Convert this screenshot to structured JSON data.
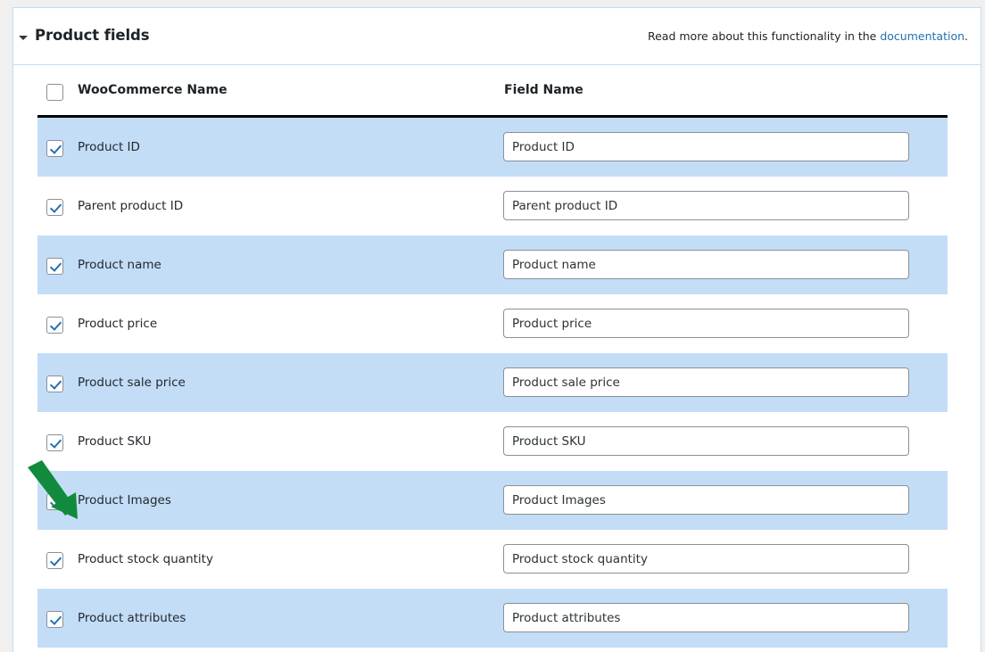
{
  "panel": {
    "title": "Product fields",
    "collapse_icon": "triangle-down-icon",
    "doc_note_prefix": "Read more about this functionality in the ",
    "doc_note_link": "documentation",
    "doc_note_suffix": ".",
    "link_color": "#2271b1"
  },
  "table": {
    "header_checkbox_checked": false,
    "columns": [
      "WooCommerce Name",
      "Field Name"
    ],
    "rows": [
      {
        "checked": true,
        "label": "Product ID",
        "value": "Product ID"
      },
      {
        "checked": true,
        "label": "Parent product ID",
        "value": "Parent product ID"
      },
      {
        "checked": true,
        "label": "Product name",
        "value": "Product name"
      },
      {
        "checked": true,
        "label": "Product price",
        "value": "Product price"
      },
      {
        "checked": true,
        "label": "Product sale price",
        "value": "Product sale price"
      },
      {
        "checked": true,
        "label": "Product SKU",
        "value": "Product SKU"
      },
      {
        "checked": true,
        "label": "Product Images",
        "value": "Product Images"
      },
      {
        "checked": true,
        "label": "Product stock quantity",
        "value": "Product stock quantity"
      },
      {
        "checked": true,
        "label": "Product attributes",
        "value": "Product attributes"
      }
    ]
  },
  "annotation": {
    "arrow_icon": "green-arrow-down-right-icon",
    "arrow_color": "#128a3e",
    "points_at": "Product Images"
  },
  "colors": {
    "row_highlight": "#c3ddf7",
    "panel_border": "#c3dcf0",
    "page_background": "#f0f0f1",
    "checkmark": "#2271b1"
  }
}
